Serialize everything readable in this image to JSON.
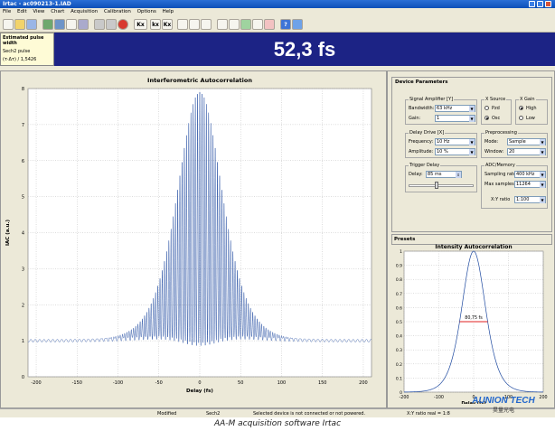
{
  "window": {
    "title": "Irtac - ac090213-1.IAD"
  },
  "menu": [
    "File",
    "Edit",
    "View",
    "Chart",
    "Acquisition",
    "Calibration",
    "Options",
    "Help"
  ],
  "toolbar": {
    "text_buttons": [
      "Kx",
      "kx",
      "Kx"
    ]
  },
  "info": {
    "heading": "Estimated pulse width",
    "pulse": "Sech2 pulse",
    "formula": "(τ·Δτ) / 1,5426"
  },
  "result": {
    "value": "52,3 fs"
  },
  "colors": {
    "accent": "#1c2385",
    "trace": "#1f4aa0",
    "fwhm_marker": "#e02020",
    "brand": "#2266cc"
  },
  "device_params": {
    "title": "Device Parameters",
    "signal_amplifier": {
      "title": "Signal Amplifier [Y]",
      "bandwidth_label": "Bandwidth:",
      "bandwidth": "63 kHz",
      "gain_label": "Gain:",
      "gain": "1"
    },
    "x_source": {
      "title": "X Source",
      "options": [
        "Pzd",
        "Osc"
      ],
      "selected": "Osc"
    },
    "x_gain": {
      "title": "X Gain",
      "options": [
        "High",
        "Low"
      ],
      "selected": "High"
    },
    "delay_drive": {
      "title": "Delay Drive [X]",
      "frequency_label": "Frequency:",
      "frequency": "10 Hz",
      "amplitude_label": "Amplitude:",
      "amplitude": "10 %"
    },
    "preprocessing": {
      "title": "Preprocessing",
      "mode_label": "Mode:",
      "mode": "Sample",
      "window_label": "Window:",
      "window": "20"
    },
    "trigger_delay": {
      "title": "Trigger Delay",
      "delay_label": "Delay:",
      "delay": "85 ms",
      "slider_fraction": 0.42
    },
    "adc_memory": {
      "title": "ADC/Memory",
      "sampling_label": "Sampling rate:",
      "sampling": "400 kHz",
      "max_samples_label": "Max samples:",
      "max_samples": "11264",
      "xy_ratio_label": "X:Y ratio",
      "xy_ratio": "1:100"
    }
  },
  "presets": {
    "title": "Presets"
  },
  "status_bar": {
    "state": "Modified",
    "pulse": "Sech2",
    "message": "Selected device is not connected or not powered.",
    "xy": "X:Y ratio real = 1:8"
  },
  "caption": "AA-M acquisition software Irtac",
  "brand": {
    "name": "AUNION TECH",
    "sub": "昊量光电"
  },
  "chart_data": [
    {
      "type": "line",
      "title": "Interferometric Autocorrelation",
      "xlabel": "Delay (fs)",
      "ylabel": "IAC (a.u.)",
      "xlim": [
        -210,
        210
      ],
      "ylim": [
        0,
        8
      ],
      "xticks": [
        -200,
        -150,
        -100,
        -50,
        0,
        50,
        100,
        150,
        200
      ],
      "yticks": [
        0,
        1,
        2,
        3,
        4,
        5,
        6,
        7,
        8
      ],
      "grid": true,
      "series": [
        {
          "baseline": 1,
          "peak": 8,
          "fringe_period_fs": 2.7,
          "envelope_width_fs": 60
        }
      ]
    },
    {
      "type": "line",
      "title": "Intensity Autocorrelation",
      "xlabel": "Delay (fs)",
      "xlim": [
        -200,
        200
      ],
      "ylim": [
        0,
        1
      ],
      "xticks": [
        -200,
        -100,
        0,
        100,
        200
      ],
      "yticks": [
        0,
        0.1,
        0.2,
        0.3,
        0.4,
        0.5,
        0.6,
        0.7,
        0.8,
        0.9,
        1
      ],
      "grid": true,
      "fwhm_label": "80,75 fs",
      "fwhm_fs": 80.75,
      "series": [
        {
          "shape": "sech2"
        }
      ]
    }
  ]
}
